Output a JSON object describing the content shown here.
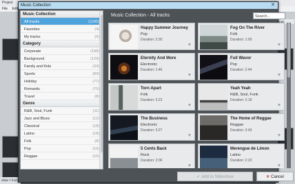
{
  "background_app": {
    "title": "Project",
    "menu": [
      "File",
      "Edit"
    ],
    "status": "Slide 7 from 1",
    "right_label": "tings"
  },
  "dialog": {
    "title": "Music Collection"
  },
  "left_panel": {
    "music_collection": {
      "heading": "Music Collection",
      "items": [
        {
          "label": "All tracks",
          "count": "(1245)",
          "selected": true
        },
        {
          "label": "Favorites",
          "count": "(4)"
        },
        {
          "label": "My tracks",
          "count": "(0)"
        }
      ]
    },
    "category": {
      "heading": "Category",
      "items": [
        {
          "label": "Corporate",
          "count": "(198)"
        },
        {
          "label": "Background",
          "count": "(129)"
        },
        {
          "label": "Family and Kids",
          "count": "(34)"
        },
        {
          "label": "Sports",
          "count": "(89)"
        },
        {
          "label": "Holiday",
          "count": "(77)"
        },
        {
          "label": "Romantic",
          "count": "(70)"
        },
        {
          "label": "Travel",
          "count": "(8)"
        }
      ]
    },
    "genre": {
      "heading": "Genre",
      "items": [
        {
          "label": "R&B, Soul, Funk",
          "count": "(11)"
        },
        {
          "label": "Jazz and Blues",
          "count": "(12)"
        },
        {
          "label": "Classical",
          "count": "(18)"
        },
        {
          "label": "Latino",
          "count": "(18)"
        },
        {
          "label": "Folk",
          "count": "(8)"
        },
        {
          "label": "Pop",
          "count": "(19)"
        },
        {
          "label": "Reggae",
          "count": "(10)"
        }
      ]
    }
  },
  "main": {
    "title": "Music Collection - All tracks",
    "search_placeholder": "Search..."
  },
  "tracks": [
    {
      "title": "Happy Summer Journey",
      "genre": "Pop",
      "duration": "Duration: 2:30"
    },
    {
      "title": "Fog On The River",
      "genre": "Folk",
      "duration": "Duration: 1:00"
    },
    {
      "title": "Eternity And More",
      "genre": "Electronic",
      "duration": "Duration: 1:46"
    },
    {
      "title": "Full Wavor",
      "genre": "Pop",
      "duration": "Duration: 2:44"
    },
    {
      "title": "Torn Apart",
      "genre": "Folk",
      "duration": "Duration: 3:23"
    },
    {
      "title": "Yeah Yeah",
      "genre": "R&B, Soul, Funk",
      "duration": "Duration: 2:18"
    },
    {
      "title": "The Business",
      "genre": "Electronic",
      "duration": "Duration: 3:27"
    },
    {
      "title": "The Home of Reggae",
      "genre": "Reggae",
      "duration": "Duration: 3:43"
    },
    {
      "title": "5 Cents Back",
      "genre": "Rock",
      "duration": "Duration: 2:06"
    },
    {
      "title": "Merengue de Limon",
      "genre": "Latino",
      "duration": "Duration: 2:23"
    }
  ],
  "footer": {
    "add_label": "Add to Slideshow",
    "cancel_label": "Cancel"
  },
  "colors": {
    "title_bar": "#b8dcf2",
    "selected": "#4fa3dc",
    "dialog_bg": "#4d5257"
  }
}
